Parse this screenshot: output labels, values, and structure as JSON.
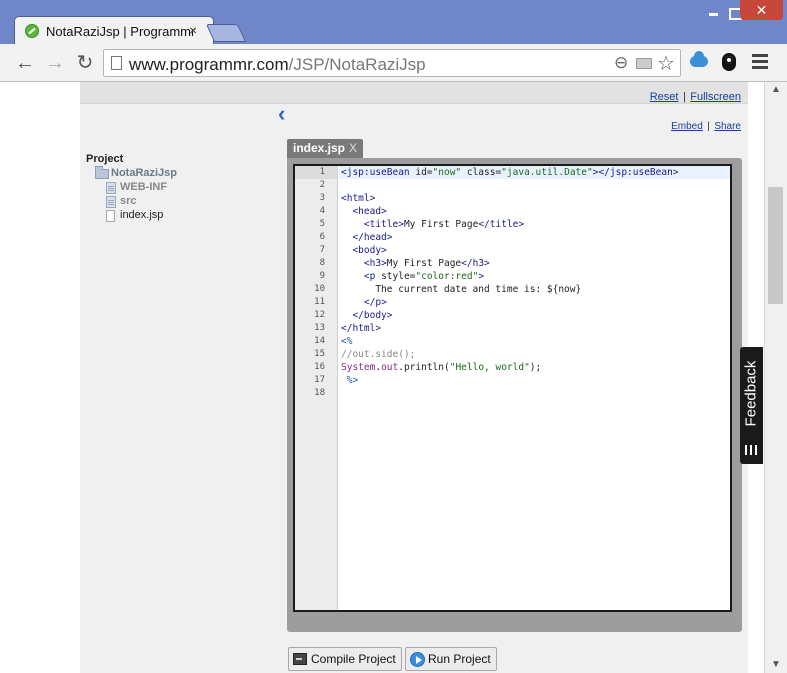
{
  "browser": {
    "tab_title": "NotaRaziJsp | Programmr",
    "tab_close": "×",
    "url_host": "www.programmr.com",
    "url_path": "/JSP/NotaRaziJsp",
    "window_close": "✕"
  },
  "page": {
    "reset_label": "Reset",
    "fullscreen_label": "Fullscreen",
    "embed_label": "Embed",
    "share_label": "Share",
    "separator": "|",
    "collapse_glyph": "‹"
  },
  "tree": {
    "title": "Project",
    "root": "NotaRaziJsp",
    "items": [
      {
        "label": "WEB-INF",
        "kind": "dir"
      },
      {
        "label": "src",
        "kind": "dir"
      },
      {
        "label": "index.jsp",
        "kind": "file"
      }
    ]
  },
  "editor": {
    "file_tab": "index.jsp",
    "file_tab_close": "X",
    "line_numbers": [
      "1",
      "2",
      "3",
      "4",
      "5",
      "6",
      "7",
      "8",
      "9",
      "10",
      "11",
      "12",
      "13",
      "14",
      "15",
      "16",
      "17",
      "18"
    ],
    "lines": [
      "<jsp:useBean id=\"now\" class=\"java.util.Date\"></jsp:useBean>",
      "",
      "<html>",
      "  <head>",
      "    <title>My First Page</title>",
      "  </head>",
      "  <body>",
      "    <h3>My First Page</h3>",
      "    <p style=\"color:red\">",
      "      The current date and time is: ${now}",
      "    </p>",
      "  </body>",
      "</html>",
      "<%",
      "//out.side();",
      "System.out.println(\"Hello, world\");",
      " %>",
      ""
    ]
  },
  "buttons": {
    "compile": "Compile Project",
    "run": "Run Project"
  },
  "feedback": {
    "label": "Feedback"
  }
}
